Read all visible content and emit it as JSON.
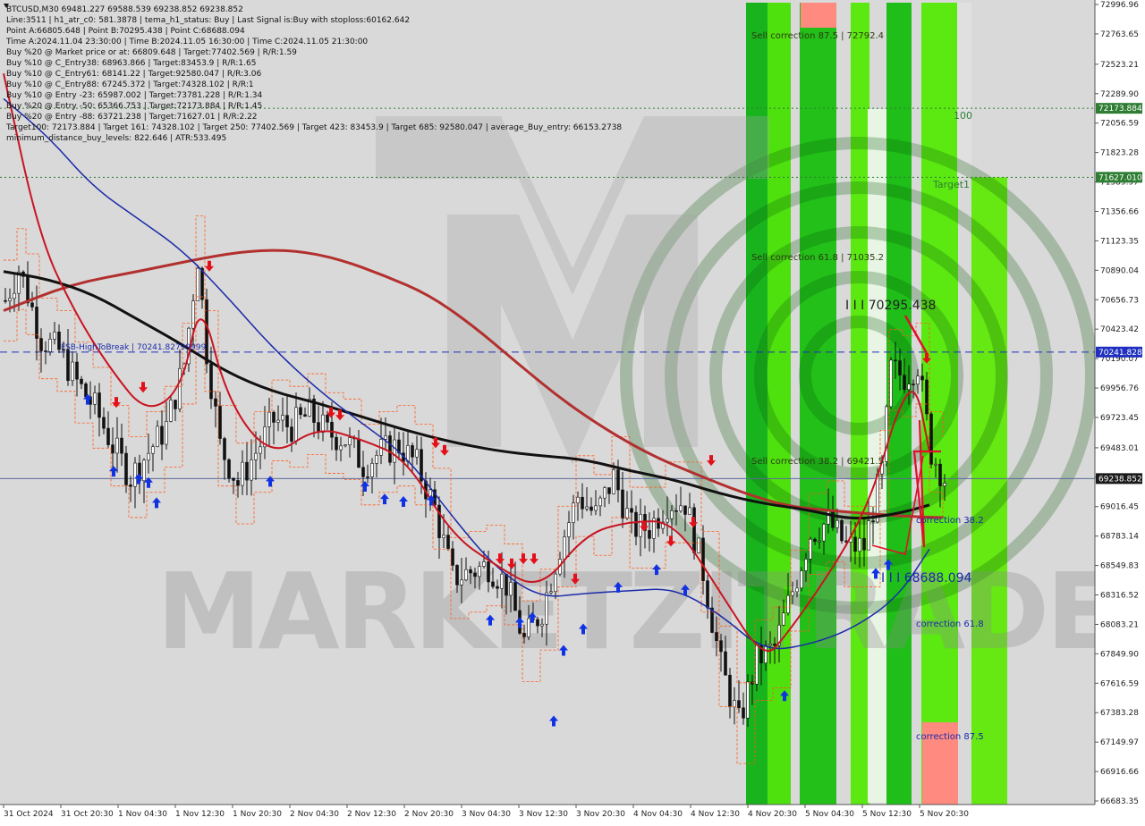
{
  "info_lines": [
    "BTCUSD,M30  69481.227 69588.539 69238.852 69238.852",
    "Line:3511  |  h1_atr_c0: 581.3878  |  tema_h1_status: Buy  |  Last Signal is:Buy with stoploss:60162.642",
    "Point A:66805.648  |  Point B:70295.438  |  Point C:68688.094",
    "Time A:2024.11.04 23:30:00  |  Time B:2024.11.05 16:30:00  |  Time C:2024.11.05 21:30:00",
    "Buy %20 @ Market price or at: 66809.648  |  Target:77402.569  |  R/R:1.59",
    "Buy %10 @ C_Entry38: 68963.866  |  Target:83453.9  |  R/R:1.65",
    "Buy %10 @ C_Entry61: 68141.22  |  Target:92580.047  |  R/R:3.06",
    "Buy %10 @ C_Entry88: 67245.372  |  Target:74328.102  |  R/R:1",
    "Buy %10 @ Entry -23: 65987.002  |  Target:73781.228  |  R/R:1.34",
    "Buy %20 @ Entry -50: 65366.753  |  Target:72173.884  |  R/R:1.45",
    "Buy %20 @ Entry -88: 63721.238  |  Target:71627.01  |  R/R:2.22",
    "Target100: 72173.884  |  Target 161: 74328.102  |  Target 250: 77402.569  |  Target 423: 83453.9  |  Target 685: 92580.047  |  average_Buy_entry: 66153.2738",
    "minimum_distance_buy_levels: 822.646  |  ATR:533.495"
  ],
  "annotations": {
    "sell_875": "Sell correction 87.5 | 72792.4",
    "sell_618": "Sell correction 61.8 | 71035.2",
    "sell_382": "Sell correction 38.2 | 69421.5",
    "point_b": "I I I 70295.438",
    "point_c": "I I I 68688.094",
    "corr_382": "correction 38.2",
    "corr_618": "correction 61.8",
    "corr_875": "correction 87.5",
    "label_100": "100",
    "label_target1": "Target1",
    "fsb_label": "FSB-HighToBreak  |  70241.82799999"
  },
  "watermark": "MARKETZITRADE",
  "chart_data": {
    "type": "candlestick",
    "symbol": "BTCUSD",
    "timeframe": "M30",
    "ylim": [
      66683.35,
      72996.96
    ],
    "y_ticks": [
      72996.96,
      72763.65,
      72523.21,
      72289.9,
      72056.59,
      71823.28,
      71589.97,
      71356.66,
      71123.35,
      70890.04,
      70656.73,
      70423.42,
      70190.07,
      69956.76,
      69723.45,
      69483.01,
      69249.7,
      69016.45,
      68783.14,
      68549.83,
      68316.52,
      68083.21,
      67849.9,
      67616.59,
      67383.28,
      67149.97,
      66916.66,
      66683.35
    ],
    "x_ticks": [
      "31 Oct 2024",
      "31 Oct 20:30",
      "1 Nov 04:30",
      "1 Nov 12:30",
      "1 Nov 20:30",
      "2 Nov 04:30",
      "2 Nov 12:30",
      "2 Nov 20:30",
      "3 Nov 04:30",
      "3 Nov 12:30",
      "3 Nov 20:30",
      "4 Nov 04:30",
      "4 Nov 12:30",
      "4 Nov 20:30",
      "5 Nov 04:30",
      "5 Nov 12:30",
      "5 Nov 20:30"
    ],
    "price_boxes": [
      {
        "value": 72173.884,
        "label": "72173.884",
        "color": "#2e7d32"
      },
      {
        "value": 71627.01,
        "label": "71627.010",
        "color": "#2e7d32"
      },
      {
        "value": 70241.828,
        "label": "70241.828",
        "color": "#1f2fbf"
      },
      {
        "value": 69238.852,
        "label": "69238.852",
        "color": "#1a1a1a"
      }
    ],
    "hlines": [
      {
        "value": 72173.884,
        "color": "#2e7d32",
        "style": "dotted"
      },
      {
        "value": 71627.01,
        "color": "#2e7d32",
        "style": "dotted"
      },
      {
        "value": 70241.828,
        "color": "#1f2fbf",
        "style": "dashed"
      },
      {
        "value": 69238.852,
        "color": "#5a6a9a",
        "style": "solid"
      }
    ],
    "ohlc_anchor_path": [
      [
        0,
        70650
      ],
      [
        3,
        70900
      ],
      [
        5,
        70700
      ],
      [
        8,
        70350
      ],
      [
        12,
        70250
      ],
      [
        16,
        70000
      ],
      [
        20,
        69800
      ],
      [
        24,
        69500
      ],
      [
        28,
        69250
      ],
      [
        32,
        69450
      ],
      [
        36,
        69650
      ],
      [
        40,
        70150
      ],
      [
        43,
        71000
      ],
      [
        45,
        70250
      ],
      [
        48,
        69500
      ],
      [
        52,
        69200
      ],
      [
        56,
        69450
      ],
      [
        60,
        69700
      ],
      [
        64,
        69650
      ],
      [
        68,
        69750
      ],
      [
        72,
        69600
      ],
      [
        76,
        69550
      ],
      [
        80,
        69350
      ],
      [
        84,
        69450
      ],
      [
        88,
        69500
      ],
      [
        92,
        69350
      ],
      [
        96,
        69000
      ],
      [
        100,
        68450
      ],
      [
        104,
        68500
      ],
      [
        108,
        68550
      ],
      [
        112,
        68400
      ],
      [
        116,
        67950
      ],
      [
        120,
        68200
      ],
      [
        124,
        68700
      ],
      [
        128,
        69100
      ],
      [
        132,
        68950
      ],
      [
        136,
        69250
      ],
      [
        140,
        68850
      ],
      [
        144,
        68850
      ],
      [
        148,
        69050
      ],
      [
        152,
        69050
      ],
      [
        156,
        68500
      ],
      [
        160,
        67750
      ],
      [
        164,
        67300
      ],
      [
        168,
        67800
      ],
      [
        172,
        67900
      ],
      [
        176,
        68350
      ],
      [
        180,
        68800
      ],
      [
        184,
        68900
      ],
      [
        188,
        68700
      ],
      [
        192,
        68700
      ],
      [
        196,
        69300
      ],
      [
        198,
        70100
      ],
      [
        201,
        70050
      ],
      [
        204,
        70150
      ],
      [
        207,
        69450
      ],
      [
        210,
        69240
      ]
    ],
    "zones": [
      {
        "x0": 834,
        "x1": 858,
        "color": "#19b31d"
      },
      {
        "x0": 858,
        "x1": 884,
        "color": "#4ee10e"
      },
      {
        "x0": 894,
        "x1": 935,
        "color": "#22c019"
      },
      {
        "x0": 951,
        "x1": 972,
        "color": "#5be911"
      },
      {
        "x0": 991,
        "x1": 1019,
        "color": "#1fbe18"
      },
      {
        "x0": 1030,
        "x1": 1071,
        "color": "#5be911"
      },
      {
        "x0": 1086,
        "x1": 1126,
        "color": "#66e812",
        "ytop": 71627.01
      }
    ],
    "sell_arrows": [
      [
        234,
        70880
      ],
      [
        130,
        69800
      ],
      [
        160,
        69920
      ],
      [
        370,
        69720
      ],
      [
        380,
        69700
      ],
      [
        487,
        69480
      ],
      [
        497,
        69420
      ],
      [
        559,
        68560
      ],
      [
        572,
        68520
      ],
      [
        585,
        68560
      ],
      [
        597,
        68560
      ],
      [
        643,
        68400
      ],
      [
        720,
        68820
      ],
      [
        750,
        68700
      ],
      [
        775,
        68850
      ],
      [
        795,
        69340
      ],
      [
        1036,
        70150
      ]
    ],
    "buy_arrows": [
      [
        98,
        69910
      ],
      [
        127,
        69340
      ],
      [
        155,
        69280
      ],
      [
        166,
        69250
      ],
      [
        175,
        69090
      ],
      [
        302,
        69260
      ],
      [
        408,
        69220
      ],
      [
        430,
        69120
      ],
      [
        451,
        69100
      ],
      [
        482,
        69110
      ],
      [
        548,
        68160
      ],
      [
        581,
        68140
      ],
      [
        595,
        68180
      ],
      [
        630,
        67920
      ],
      [
        652,
        68090
      ],
      [
        619,
        67360
      ],
      [
        691,
        68420
      ],
      [
        734,
        68560
      ],
      [
        766,
        68400
      ],
      [
        877,
        67560
      ],
      [
        979,
        68530
      ],
      [
        993,
        68600
      ]
    ],
    "series": [
      {
        "name": "",
        "color": "#b2302e",
        "width": 3,
        "values": [
          [
            0,
            70570
          ],
          [
            15,
            70780
          ],
          [
            30,
            70880
          ],
          [
            45,
            70990
          ],
          [
            55,
            71045
          ],
          [
            65,
            71050
          ],
          [
            75,
            70980
          ],
          [
            85,
            70850
          ],
          [
            95,
            70700
          ],
          [
            105,
            70450
          ],
          [
            115,
            70150
          ],
          [
            125,
            69860
          ],
          [
            135,
            69620
          ],
          [
            145,
            69420
          ],
          [
            155,
            69270
          ],
          [
            165,
            69130
          ],
          [
            175,
            69020
          ],
          [
            185,
            68985
          ],
          [
            195,
            68955
          ],
          [
            205,
            68935
          ],
          [
            210,
            68930
          ]
        ]
      },
      {
        "name": "",
        "color": "#111111",
        "width": 3,
        "values": [
          [
            0,
            70880
          ],
          [
            10,
            70820
          ],
          [
            20,
            70700
          ],
          [
            30,
            70500
          ],
          [
            40,
            70300
          ],
          [
            50,
            70080
          ],
          [
            60,
            69930
          ],
          [
            70,
            69840
          ],
          [
            80,
            69730
          ],
          [
            90,
            69620
          ],
          [
            100,
            69530
          ],
          [
            110,
            69460
          ],
          [
            120,
            69420
          ],
          [
            130,
            69390
          ],
          [
            140,
            69300
          ],
          [
            150,
            69230
          ],
          [
            160,
            69120
          ],
          [
            170,
            69040
          ],
          [
            180,
            68990
          ],
          [
            190,
            68910
          ],
          [
            200,
            68960
          ],
          [
            207,
            69030
          ]
        ]
      },
      {
        "name": "",
        "color": "#1a2aa8",
        "width": 1.5,
        "values": [
          [
            0,
            72250
          ],
          [
            10,
            71950
          ],
          [
            20,
            71550
          ],
          [
            30,
            71300
          ],
          [
            40,
            71050
          ],
          [
            50,
            70680
          ],
          [
            60,
            70280
          ],
          [
            70,
            69950
          ],
          [
            80,
            69680
          ],
          [
            90,
            69420
          ],
          [
            100,
            68950
          ],
          [
            110,
            68530
          ],
          [
            120,
            68290
          ],
          [
            130,
            68330
          ],
          [
            140,
            68350
          ],
          [
            150,
            68370
          ],
          [
            160,
            68170
          ],
          [
            170,
            67870
          ],
          [
            180,
            67920
          ],
          [
            190,
            68050
          ],
          [
            200,
            68300
          ],
          [
            207,
            68680
          ]
        ]
      },
      {
        "name": "",
        "color": "#c81421",
        "width": 2,
        "values": [
          [
            0,
            72450
          ],
          [
            8,
            71150
          ],
          [
            16,
            70550
          ],
          [
            24,
            70100
          ],
          [
            32,
            69750
          ],
          [
            40,
            69950
          ],
          [
            44,
            70700
          ],
          [
            50,
            69850
          ],
          [
            60,
            69400
          ],
          [
            70,
            69650
          ],
          [
            80,
            69550
          ],
          [
            90,
            69400
          ],
          [
            100,
            68800
          ],
          [
            110,
            68550
          ],
          [
            120,
            68350
          ],
          [
            130,
            68800
          ],
          [
            140,
            68900
          ],
          [
            150,
            68900
          ],
          [
            160,
            68350
          ],
          [
            170,
            67800
          ],
          [
            175,
            68000
          ],
          [
            183,
            68400
          ],
          [
            190,
            68800
          ],
          [
            195,
            69200
          ],
          [
            200,
            69800
          ],
          [
            204,
            70000
          ],
          [
            207,
            69450
          ]
        ]
      }
    ]
  }
}
